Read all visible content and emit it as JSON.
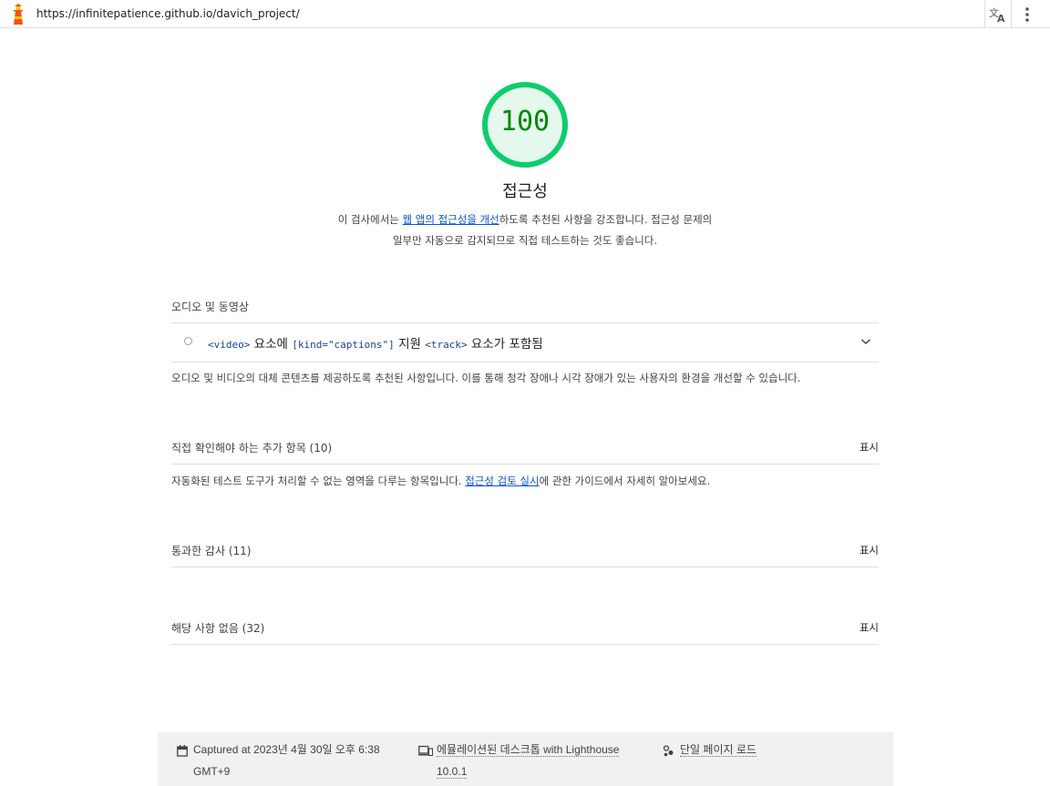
{
  "browser": {
    "url": "https://infinitepatience.github.io/davich_project/",
    "logo_icon": "lighthouse-icon",
    "translate_icon": "translate-icon",
    "menu_icon": "more-vert-icon"
  },
  "category": {
    "score": "100",
    "score_color": "#008800",
    "gauge_color": "#0cce6b",
    "title": "접근성",
    "description_before": "이 검사에서는 ",
    "description_link": "웹 앱의 접근성을 개선",
    "description_after": "하도록 추천된 사항을 강조합니다. 접근성 문제의 일부만 자동으로 감지되므로 직접 테스트하는 것도 좋습니다."
  },
  "audio_group": {
    "title": "오디오 및 동영상",
    "audit": {
      "code1": "<video>",
      "text1": " 요소에 ",
      "code2": "[kind=\"captions\"]",
      "text2": " 지원 ",
      "code3": "<track>",
      "text3": " 요소가 포함됨"
    },
    "description": "오디오 및 비디오의 대체 콘텐츠를 제공하도록 추천된 사항입니다. 이를 통해 청각 장애나 시각 장애가 있는 사용자의 환경을 개선할 수 있습니다."
  },
  "manual_group": {
    "title": "직접 확인해야 하는 추가 항목 (10)",
    "show_label": "표시",
    "description_before": "자동화된 테스트 도구가 처리할 수 없는 영역을 다루는 항목입니다. ",
    "description_link": "접근성 검토 실시",
    "description_after": "에 관한 가이드에서 자세히 알아보세요."
  },
  "passed_group": {
    "title": "통과한 감사 (11)",
    "show_label": "표시"
  },
  "na_group": {
    "title": "해당 사항 없음 (32)",
    "show_label": "표시"
  },
  "footer": {
    "captured_line1": "Captured at 2023년 4월 30일 오후 6:38",
    "captured_line2": "GMT+9",
    "device_line1": "에뮬레이션된 데스크톱 with Lighthouse",
    "device_line2": "10.0.1",
    "load_label": "단일 페이지 로드",
    "calendar_icon": "calendar-icon",
    "device_icon": "devices-icon",
    "load_icon": "page-load-icon"
  }
}
